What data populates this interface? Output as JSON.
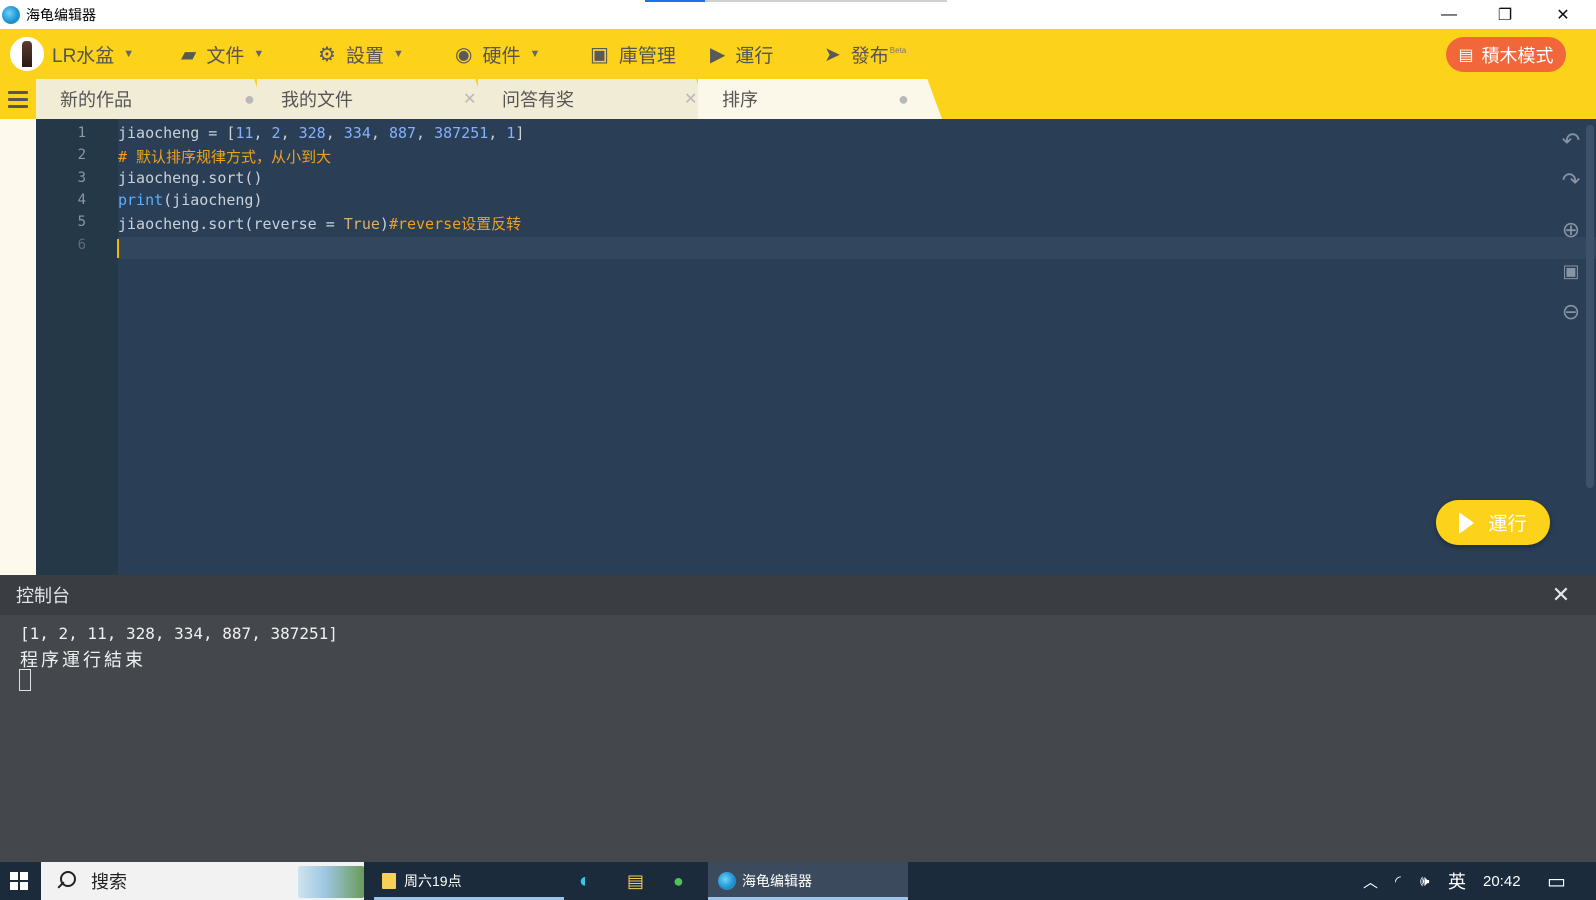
{
  "window": {
    "title": "海龟编辑器",
    "minimize": "—",
    "maximize": "❐",
    "close": "✕"
  },
  "toolbar": {
    "user": "LR水盆",
    "file": "文件",
    "settings": "設置",
    "hardware": "硬件",
    "library": "庫管理",
    "run": "運行",
    "publish": "發布",
    "beta": "Beta",
    "block_mode": "積木模式"
  },
  "tabs": [
    {
      "label": "新的作品",
      "marker": "●"
    },
    {
      "label": "我的文件",
      "marker": "✕"
    },
    {
      "label": "问答有奖",
      "marker": "✕"
    },
    {
      "label": "排序",
      "marker": "●"
    }
  ],
  "editor": {
    "line_numbers": [
      "1",
      "2",
      "3",
      "4",
      "5",
      "6"
    ],
    "lines": [
      "jiaocheng = [11, 2, 328, 334, 887, 387251, 1]",
      "# 默认排序规律方式，从小到大",
      "jiaocheng.sort()",
      "print(jiaocheng)",
      "jiaocheng.sort(reverse = True)#reverse设置反转",
      ""
    ],
    "tokens": {
      "l1_name": "jiaocheng = [",
      "l1_n1": "11",
      "l1_n2": "2",
      "l1_n3": "328",
      "l1_n4": "334",
      "l1_n5": "887",
      "l1_n6": "387251",
      "l1_n7": "1",
      "l1_sep": ", ",
      "l1_end": "]",
      "l2": "# 默认排序规律方式，从小到大",
      "l3": "jiaocheng.sort()",
      "l4_kw": "print",
      "l4_rest": "(jiaocheng)",
      "l5_a": "jiaocheng.sort(reverse = ",
      "l5_bool": "True",
      "l5_b": ")",
      "l5_cmt": "#reverse设置反转"
    },
    "run_button": "運行"
  },
  "console": {
    "title": "控制台",
    "close": "✕",
    "output": [
      "[1, 2, 11, 328, 334, 887, 387251]",
      "程序運行結束"
    ]
  },
  "taskbar": {
    "search_placeholder": "搜索",
    "items": [
      {
        "label": "周六19点"
      },
      {
        "label": "海龟编辑器"
      }
    ],
    "ime": "英",
    "time": "20:42"
  },
  "colors": {
    "toolbar_yellow": "#fdd21a",
    "block_mode_orange": "#f2673a",
    "editor_bg": "#2a3f56",
    "comment": "#f0a11c",
    "number": "#86b0ff",
    "keyword": "#5aaeff"
  }
}
